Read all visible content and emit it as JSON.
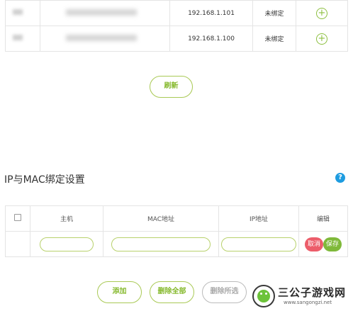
{
  "device_list": {
    "rows": [
      {
        "ip": "192.168.1.101",
        "status": "未绑定"
      },
      {
        "ip": "192.168.1.100",
        "status": "未绑定"
      }
    ],
    "add_symbol": "+"
  },
  "refresh_label": "刷新",
  "binding": {
    "title": "IP与MAC绑定设置",
    "help_symbol": "?",
    "headers": {
      "host": "主机",
      "mac": "MAC地址",
      "ip": "IP地址",
      "edit": "编辑"
    },
    "inputs": {
      "host": "",
      "mac": "",
      "ip": ""
    },
    "cancel_label": "取消",
    "save_label": "保存"
  },
  "actions": {
    "add": "添加",
    "delete_all": "删除全部",
    "delete_selected": "删除所选"
  },
  "watermark": {
    "title": "三公子游戏网",
    "url": "www.sangongzi.net"
  },
  "colors": {
    "accent_green": "#86b92d",
    "help_blue": "#1e9ce0",
    "cancel_red": "#ec5d6a",
    "save_green": "#7fb93a"
  }
}
